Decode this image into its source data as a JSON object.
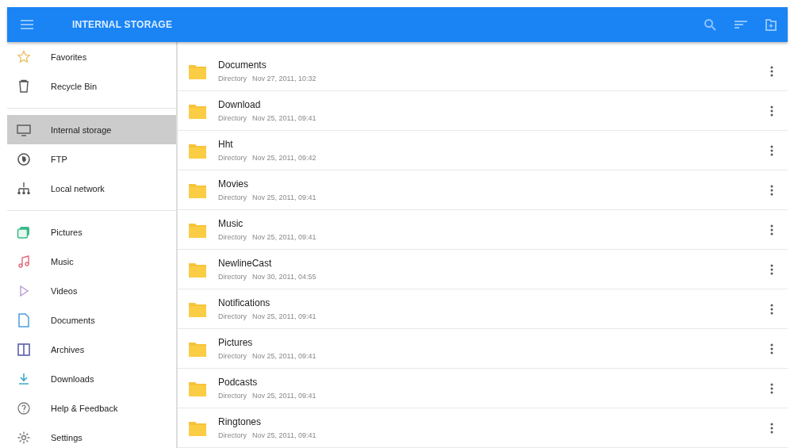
{
  "toolbar": {
    "title": "INTERNAL STORAGE"
  },
  "sidebar": {
    "groups": [
      [
        {
          "label": "Favorites",
          "kind": "star",
          "selected": false
        },
        {
          "label": "Recycle Bin",
          "kind": "bin",
          "selected": false
        }
      ],
      [
        {
          "label": "Internal storage",
          "kind": "monitor",
          "selected": true
        },
        {
          "label": "FTP",
          "kind": "globe",
          "selected": false
        },
        {
          "label": "Local network",
          "kind": "network",
          "selected": false
        }
      ],
      [
        {
          "label": "Pictures",
          "kind": "pictures",
          "selected": false
        },
        {
          "label": "Music",
          "kind": "music",
          "selected": false
        },
        {
          "label": "Videos",
          "kind": "play",
          "selected": false
        },
        {
          "label": "Documents",
          "kind": "document",
          "selected": false
        },
        {
          "label": "Archives",
          "kind": "archive",
          "selected": false
        },
        {
          "label": "Downloads",
          "kind": "download",
          "selected": false
        },
        {
          "label": "Help & Feedback",
          "kind": "help",
          "selected": false
        },
        {
          "label": "Settings",
          "kind": "gear",
          "selected": false
        }
      ]
    ]
  },
  "files": [
    {
      "name": "Documents",
      "type": "Directory",
      "modified": "Nov 27, 2011, 10:32"
    },
    {
      "name": "Download",
      "type": "Directory",
      "modified": "Nov 25, 2011, 09:41"
    },
    {
      "name": "Hht",
      "type": "Directory",
      "modified": "Nov 25, 2011, 09:42"
    },
    {
      "name": "Movies",
      "type": "Directory",
      "modified": "Nov 25, 2011, 09:41"
    },
    {
      "name": "Music",
      "type": "Directory",
      "modified": "Nov 25, 2011, 09:41"
    },
    {
      "name": "NewlineCast",
      "type": "Directory",
      "modified": "Nov 30, 2011, 04:55"
    },
    {
      "name": "Notifications",
      "type": "Directory",
      "modified": "Nov 25, 2011, 09:41"
    },
    {
      "name": "Pictures",
      "type": "Directory",
      "modified": "Nov 25, 2011, 09:41"
    },
    {
      "name": "Podcasts",
      "type": "Directory",
      "modified": "Nov 25, 2011, 09:41"
    },
    {
      "name": "Ringtones",
      "type": "Directory",
      "modified": "Nov 25, 2011, 09:41"
    }
  ]
}
